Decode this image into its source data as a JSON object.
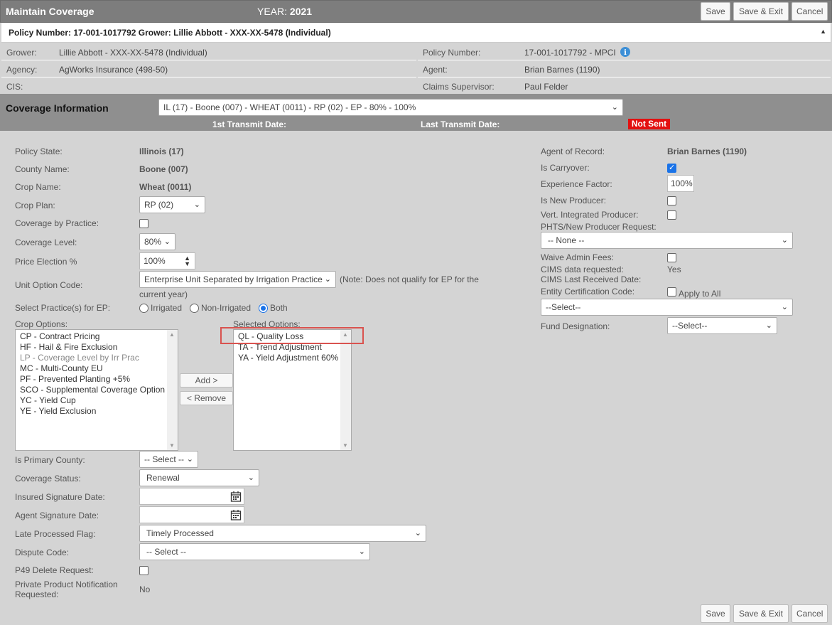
{
  "header": {
    "title": "Maintain Coverage",
    "year_label": "YEAR:",
    "year": "2021",
    "save": "Save",
    "save_exit": "Save & Exit",
    "cancel": "Cancel"
  },
  "policy_header": "Policy Number: 17-001-1017792 Grower: Lillie Abbott - XXX-XX-5478 (Individual)",
  "info": {
    "grower_label": "Grower:",
    "grower": "Lillie Abbott - XXX-XX-5478 (Individual)",
    "policy_label": "Policy Number:",
    "policy": "17-001-1017792 - MPCI",
    "agency_label": "Agency:",
    "agency": "AgWorks Insurance (498-50)",
    "agent_label": "Agent:",
    "agent": "Brian Barnes (1190)",
    "cis_label": "CIS:",
    "claims_label": "Claims Supervisor:",
    "claims": "Paul Felder"
  },
  "coverage": {
    "title": "Coverage Information",
    "selector": "IL (17) - Boone (007) - WHEAT (0011) - RP (02) - EP - 80% - 100%",
    "first_transmit": "1st Transmit Date:",
    "last_transmit": "Last Transmit Date:",
    "status_badge": "Not Sent"
  },
  "left": {
    "policy_state_label": "Policy State:",
    "policy_state": "Illinois (17)",
    "county_label": "County Name:",
    "county": "Boone (007)",
    "crop_label": "Crop Name:",
    "crop": "Wheat (0011)",
    "crop_plan_label": "Crop Plan:",
    "crop_plan": "RP (02)",
    "cov_practice_label": "Coverage by Practice:",
    "cov_level_label": "Coverage Level:",
    "cov_level": "80%",
    "price_election_label": "Price Election %",
    "price_election": "100%",
    "unit_option_label": "Unit Option Code:",
    "unit_option": "Enterprise Unit Separated by Irrigation Practice",
    "unit_note_1": "(Note: Does not qualify for EP for the",
    "unit_note_2": "current year)",
    "practice_label": "Select Practice(s) for EP:",
    "practice_options": [
      "Irrigated",
      "Non-Irrigated",
      "Both"
    ],
    "crop_options_label": "Crop Options:",
    "crop_options": [
      "CP - Contract Pricing",
      "HF - Hail & Fire Exclusion",
      "LP - Coverage Level by Irr Prac",
      "MC - Multi-County EU",
      "PF - Prevented Planting +5%",
      "SCO - Supplemental Coverage Option",
      "YC - Yield Cup",
      "YE - Yield Exclusion"
    ],
    "selected_options_label": "Selected Options:",
    "selected_options": [
      "QL - Quality Loss",
      "TA - Trend Adjustment",
      "YA - Yield Adjustment 60%"
    ],
    "add_button": "Add >",
    "remove_button": "< Remove",
    "primary_county_label": "Is Primary County:",
    "primary_county": "-- Select --",
    "coverage_status_label": "Coverage Status:",
    "coverage_status": "Renewal",
    "insured_sig_label": "Insured Signature Date:",
    "agent_sig_label": "Agent Signature Date:",
    "late_flag_label": "Late Processed Flag:",
    "late_flag": "Timely Processed",
    "dispute_label": "Dispute Code:",
    "dispute": "-- Select --",
    "p49_label": "P49 Delete Request:",
    "private_label_1": "Private Product Notification",
    "private_label_2": "Requested:",
    "private_value": "No"
  },
  "right": {
    "agent_record_label": "Agent of Record:",
    "agent_record": "Brian Barnes (1190)",
    "carryover_label": "Is Carryover:",
    "experience_label": "Experience Factor:",
    "experience": "100%",
    "new_producer_label": "Is New Producer:",
    "vert_label": "Vert. Integrated Producer:",
    "phts_label": "PHTS/New Producer Request:",
    "phts": "-- None --",
    "waive_label": "Waive Admin Fees:",
    "cims_label": "CIMS data requested:",
    "cims": "Yes",
    "cims_last_label": "CIMS Last Received Date:",
    "entity_label": "Entity Certification Code:",
    "apply_all": "Apply to All",
    "entity_select": "--Select--",
    "fund_label": "Fund Designation:",
    "fund": "--Select--"
  }
}
